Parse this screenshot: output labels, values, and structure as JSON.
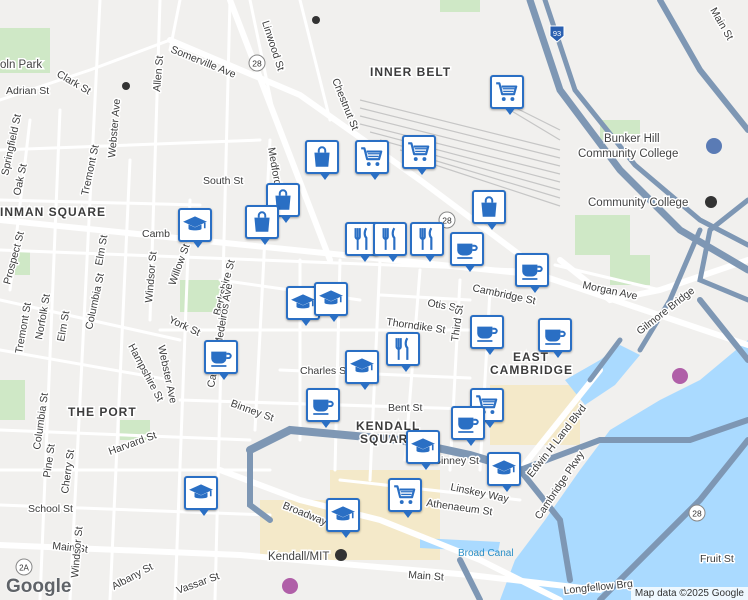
{
  "areas": {
    "inner_belt": "INNER BELT",
    "inman_square": "INMAN SQUARE",
    "the_port": "THE PORT",
    "east_cambridge_1": "EAST",
    "east_cambridge_2": "CAMBRIDGE",
    "kendall_1": "KENDALL",
    "kendall_2": "SQUARE"
  },
  "streets": {
    "clark": "Clark St",
    "adrian": "Adrian St",
    "allen": "Allen St",
    "somerville": "Somerville Ave",
    "webster_ave": "Webster Ave",
    "linwood": "Linwood St",
    "chestnut": "Chestnut St",
    "south": "South St",
    "medford": "Medford St",
    "tremont_top": "Tremont St",
    "oak": "Oak St",
    "springfield": "Springfield St",
    "cambridge_left": "Camb",
    "cambridge_right": "Cambridge St",
    "prospect": "Prospect St",
    "elm": "Elm St",
    "columbia": "Columbia St",
    "windsor": "Windsor St",
    "willow": "Willow St",
    "berkshire": "Berkshire St",
    "tremont": "Tremont St",
    "norfolk": "Norfolk St",
    "elm2": "Elm St",
    "york": "York St",
    "hampshire": "Hampshire St",
    "webster2": "Webster Ave",
    "cardinal": "Cardinal Medeiros Ave",
    "otis": "Otis St",
    "thorndike": "Thorndike St",
    "third": "Third St",
    "morgan": "Morgan Ave",
    "gilmore": "Gilmore Bridge",
    "charles": "Charles St",
    "binney": "Binney St",
    "bent": "Bent St",
    "harvard": "Harvard St",
    "columbia2": "Columbia St",
    "pine": "Pine St",
    "cherry": "Cherry St",
    "school": "School St",
    "main_left": "Main St",
    "windsor2": "Windsor St",
    "albany": "Albany St",
    "vassar": "Vassar St",
    "broadway": "Broadway",
    "kendall_mit": "Kendall/MIT",
    "main_bottom": "Main St",
    "longfellow": "Longfellow Brg",
    "linskey": "Linskey Way",
    "athenaeum": "Athenaeum St",
    "edwin": "Edwin H Land Blvd",
    "cambridge_pkwy": "Cambridge Pkwy",
    "fruit": "Fruit St",
    "main_top": "Main St",
    "binney2": "Binney St",
    "broad_canal": "Broad Canal",
    "route28": "28",
    "route2a": "2A",
    "route93": "93",
    "community_college": "Community College",
    "bunker_hill_1": "Bunker Hill",
    "bunker_hill_2": "Community College",
    "lin_park": "oln Park"
  },
  "markers": [
    {
      "type": "grocery",
      "icon": "shopping-cart-icon"
    },
    {
      "type": "shopping",
      "icon": "shopping-bag-icon"
    },
    {
      "type": "grocery",
      "icon": "shopping-cart-icon"
    },
    {
      "type": "grocery",
      "icon": "shopping-cart-icon"
    },
    {
      "type": "shopping",
      "icon": "shopping-bag-icon"
    },
    {
      "type": "school",
      "icon": "graduation-cap-icon"
    },
    {
      "type": "shopping",
      "icon": "shopping-bag-icon"
    },
    {
      "type": "shopping",
      "icon": "shopping-bag-icon"
    },
    {
      "type": "restaurant",
      "icon": "fork-knife-icon"
    },
    {
      "type": "restaurant",
      "icon": "fork-knife-icon"
    },
    {
      "type": "restaurant",
      "icon": "fork-knife-icon"
    },
    {
      "type": "cafe",
      "icon": "coffee-cup-icon"
    },
    {
      "type": "cafe",
      "icon": "coffee-cup-icon"
    },
    {
      "type": "school",
      "icon": "graduation-cap-icon"
    },
    {
      "type": "school",
      "icon": "graduation-cap-icon"
    },
    {
      "type": "cafe",
      "icon": "coffee-cup-icon"
    },
    {
      "type": "cafe",
      "icon": "coffee-cup-icon"
    },
    {
      "type": "restaurant",
      "icon": "fork-knife-icon"
    },
    {
      "type": "cafe",
      "icon": "coffee-cup-icon"
    },
    {
      "type": "school",
      "icon": "graduation-cap-icon"
    },
    {
      "type": "cafe",
      "icon": "coffee-cup-icon"
    },
    {
      "type": "grocery",
      "icon": "shopping-cart-icon"
    },
    {
      "type": "cafe",
      "icon": "coffee-cup-icon"
    },
    {
      "type": "school",
      "icon": "graduation-cap-icon"
    },
    {
      "type": "school",
      "icon": "graduation-cap-icon"
    },
    {
      "type": "school",
      "icon": "graduation-cap-icon"
    },
    {
      "type": "grocery",
      "icon": "shopping-cart-icon"
    },
    {
      "type": "school",
      "icon": "graduation-cap-icon"
    }
  ],
  "branding": {
    "logo": "Google",
    "attribution": "Map data ©2025 Google"
  },
  "colors": {
    "marker_border": "#2a6fc4",
    "water": "#aadaff",
    "highway": "#7e97b4",
    "park": "#c8e6c0"
  }
}
